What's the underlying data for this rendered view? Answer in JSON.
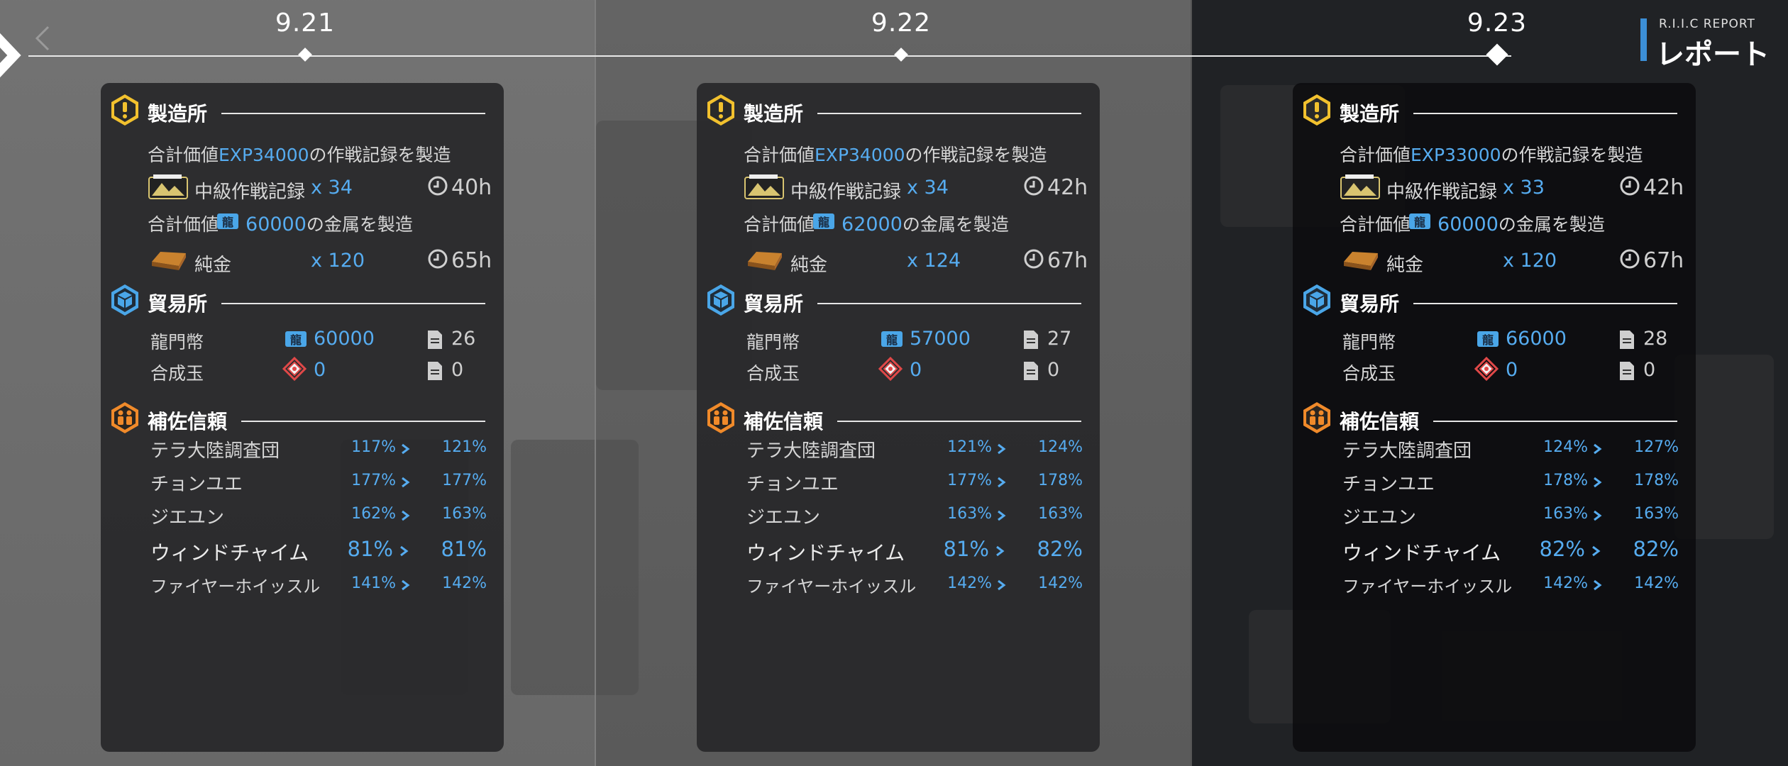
{
  "report": {
    "subtitle": "R.I.I.C REPORT",
    "title": "レポート"
  },
  "dates": [
    "9.21",
    "9.22",
    "9.23"
  ],
  "days": [
    {
      "factory": {
        "title": "製造所",
        "exp_pre": "合計価値",
        "exp_value": "EXP34000",
        "exp_post": "の作戦記録を製造",
        "record_name": "中級作戦記録",
        "record_count": "x 34",
        "record_time": "40h",
        "metal_pre": "合計価値",
        "metal_value": "60000",
        "metal_post": "の金属を製造",
        "gold_name": "純金",
        "gold_count": "x 120",
        "gold_time": "65h"
      },
      "trade": {
        "title": "貿易所",
        "lmd_name": "龍門幣",
        "lmd_value": "60000",
        "lmd_orders": "26",
        "orundum_name": "合成玉",
        "orundum_value": "0",
        "orundum_orders": "0"
      },
      "trust": {
        "title": "補佐信頼",
        "rows": [
          {
            "name": "テラ大陸調査団",
            "from": "117%",
            "to": "121%"
          },
          {
            "name": "チョンユエ",
            "from": "177%",
            "to": "177%"
          },
          {
            "name": "ジエユン",
            "from": "162%",
            "to": "163%"
          },
          {
            "name": "ウィンドチャイム",
            "from": "81%",
            "to": "81%"
          },
          {
            "name": "ファイヤーホイッスル",
            "from": "141%",
            "to": "142%"
          }
        ]
      }
    },
    {
      "factory": {
        "title": "製造所",
        "exp_pre": "合計価値",
        "exp_value": "EXP34000",
        "exp_post": "の作戦記録を製造",
        "record_name": "中級作戦記録",
        "record_count": "x 34",
        "record_time": "42h",
        "metal_pre": "合計価値",
        "metal_value": "62000",
        "metal_post": "の金属を製造",
        "gold_name": "純金",
        "gold_count": "x 124",
        "gold_time": "67h"
      },
      "trade": {
        "title": "貿易所",
        "lmd_name": "龍門幣",
        "lmd_value": "57000",
        "lmd_orders": "27",
        "orundum_name": "合成玉",
        "orundum_value": "0",
        "orundum_orders": "0"
      },
      "trust": {
        "title": "補佐信頼",
        "rows": [
          {
            "name": "テラ大陸調査団",
            "from": "121%",
            "to": "124%"
          },
          {
            "name": "チョンユエ",
            "from": "177%",
            "to": "178%"
          },
          {
            "name": "ジエユン",
            "from": "163%",
            "to": "163%"
          },
          {
            "name": "ウィンドチャイム",
            "from": "81%",
            "to": "82%"
          },
          {
            "name": "ファイヤーホイッスル",
            "from": "142%",
            "to": "142%"
          }
        ]
      }
    },
    {
      "factory": {
        "title": "製造所",
        "exp_pre": "合計価値",
        "exp_value": "EXP33000",
        "exp_post": "の作戦記録を製造",
        "record_name": "中級作戦記録",
        "record_count": "x 33",
        "record_time": "42h",
        "metal_pre": "合計価値",
        "metal_value": "60000",
        "metal_post": "の金属を製造",
        "gold_name": "純金",
        "gold_count": "x 120",
        "gold_time": "67h"
      },
      "trade": {
        "title": "貿易所",
        "lmd_name": "龍門幣",
        "lmd_value": "66000",
        "lmd_orders": "28",
        "orundum_name": "合成玉",
        "orundum_value": "0",
        "orundum_orders": "0"
      },
      "trust": {
        "title": "補佐信頼",
        "rows": [
          {
            "name": "テラ大陸調査団",
            "from": "124%",
            "to": "127%"
          },
          {
            "name": "チョンユエ",
            "from": "178%",
            "to": "178%"
          },
          {
            "name": "ジエユン",
            "from": "163%",
            "to": "163%"
          },
          {
            "name": "ウィンドチャイム",
            "from": "82%",
            "to": "82%"
          },
          {
            "name": "ファイヤーホイッスル",
            "from": "142%",
            "to": "142%"
          }
        ]
      }
    }
  ],
  "colors": {
    "accent_blue": "#56acf0",
    "factory_icon": "#f2c12e",
    "trade_icon": "#4aa6e8",
    "trust_icon": "#f08a2a"
  },
  "icons": [
    "chevron-left-icon",
    "factory-icon",
    "trade-icon",
    "trust-icon",
    "clock-icon",
    "battle-record-icon",
    "pure-gold-icon",
    "lmd-icon",
    "orundum-icon",
    "order-document-icon",
    "arrow-right-icon"
  ]
}
